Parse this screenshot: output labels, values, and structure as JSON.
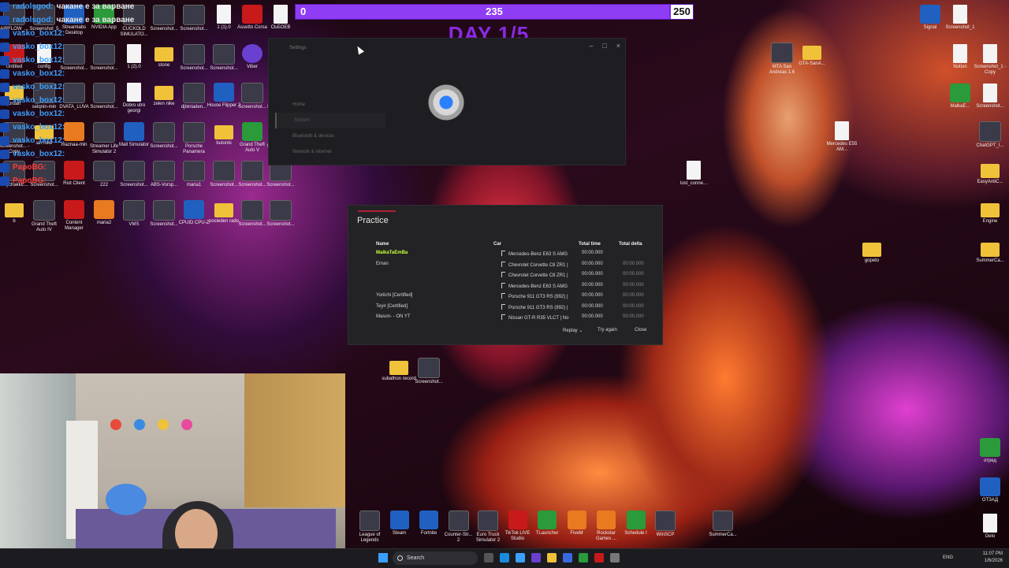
{
  "overlay": {
    "progress": {
      "start": "0",
      "current": "235",
      "end": "250",
      "fraction": 0.94
    },
    "day_label": "DAY 1/5"
  },
  "chat": [
    {
      "user": "radolsgod",
      "message": "чакане е за варване",
      "color": "blue"
    },
    {
      "user": "radolsgod",
      "message": "чакане е за варване",
      "color": "blue"
    },
    {
      "user": "vasko_box12",
      "message": "",
      "color": "blue"
    },
    {
      "user": "vasko_box12",
      "message": "",
      "color": "blue"
    },
    {
      "user": "vasko_box12",
      "message": "",
      "color": "blue"
    },
    {
      "user": "vasko_box12",
      "message": "",
      "color": "blue"
    },
    {
      "user": "vasko_box12",
      "message": "",
      "color": "blue"
    },
    {
      "user": "vasko_box12",
      "message": "",
      "color": "blue"
    },
    {
      "user": "vasko_box12",
      "message": "",
      "color": "blue"
    },
    {
      "user": "vasko_box12",
      "message": "",
      "color": "blue"
    },
    {
      "user": "vasko_box12",
      "message": "",
      "color": "blue"
    },
    {
      "user": "vasko_box12",
      "message": "",
      "color": "blue"
    },
    {
      "user": "PapoBG",
      "message": "",
      "color": "red"
    },
    {
      "user": "PapoBG",
      "message": "",
      "color": "red"
    }
  ],
  "desktop_icons_left": [
    {
      "label": "AIRFLOW_...",
      "kind": "shot"
    },
    {
      "label": "Screenshot_5",
      "kind": "shot"
    },
    {
      "label": "Streamlabs Desktop",
      "kind": "blue"
    },
    {
      "label": "NVIDIA App",
      "kind": "green"
    },
    {
      "label": "CUCKOLD SIMULATO...",
      "kind": "shot"
    },
    {
      "label": "Screenshot...",
      "kind": "shot"
    },
    {
      "label": "Screenshot...",
      "kind": "shot"
    },
    {
      "label": "1 (1).0",
      "kind": "file"
    },
    {
      "label": "Assetto Corsa",
      "kind": "red"
    },
    {
      "label": "СЬБОЕВ",
      "kind": "file"
    },
    {
      "label": "Untitled",
      "kind": "red"
    },
    {
      "label": "config",
      "kind": "file"
    },
    {
      "label": "Screenshot...",
      "kind": "shot"
    },
    {
      "label": "Screenshot...",
      "kind": "shot"
    },
    {
      "label": "1 (2).0",
      "kind": "file"
    },
    {
      "label": "stone",
      "kind": "folder"
    },
    {
      "label": "Screenshot...",
      "kind": "shot"
    },
    {
      "label": "Screenshot...",
      "kind": "shot"
    },
    {
      "label": "Viber",
      "kind": "purple"
    },
    {
      "label": "1 (3).0",
      "kind": "file"
    },
    {
      "label": "jordan",
      "kind": "folder"
    },
    {
      "label": "selqnin-min",
      "kind": "shot"
    },
    {
      "label": "DVATA_LUVA",
      "kind": "shot"
    },
    {
      "label": "Screenshot...",
      "kind": "shot"
    },
    {
      "label": "Dobro utro georgi",
      "kind": "file"
    },
    {
      "label": "zelen nike",
      "kind": "folder"
    },
    {
      "label": "djbinladen...",
      "kind": "shot"
    },
    {
      "label": "House Flipper 2",
      "kind": "blue"
    },
    {
      "label": "Screenshot...",
      "kind": "shot"
    },
    {
      "label": "Phasmoph...",
      "kind": "shot"
    },
    {
      "label": "Screenshot... - Copy",
      "kind": "shot"
    },
    {
      "label": "sin nike",
      "kind": "folder"
    },
    {
      "label": "maznaa-min",
      "kind": "orange"
    },
    {
      "label": "Streamer Life Simulator 2",
      "kind": "shot"
    },
    {
      "label": "Mall Simulator",
      "kind": "blue"
    },
    {
      "label": "Screenshot...",
      "kind": "shot"
    },
    {
      "label": "Porsche Panamera",
      "kind": "shot"
    },
    {
      "label": "butonki",
      "kind": "folder"
    },
    {
      "label": "Grand Theft Auto V",
      "kind": "green"
    },
    {
      "label": "Screenshot...",
      "kind": "shot"
    },
    {
      "label": "HaychakkE...",
      "kind": "shot"
    },
    {
      "label": "Screenshot...",
      "kind": "shot"
    },
    {
      "label": "Riot Client",
      "kind": "red"
    },
    {
      "label": "222",
      "kind": "shot"
    },
    {
      "label": "Screenshot...",
      "kind": "shot"
    },
    {
      "label": "ABS-Vorsp...",
      "kind": "shot"
    },
    {
      "label": "maria1",
      "kind": "shot"
    },
    {
      "label": "Screenshot...",
      "kind": "shot"
    },
    {
      "label": "Screenshot...",
      "kind": "shot"
    },
    {
      "label": "Screenshot...",
      "kind": "shot"
    },
    {
      "label": "b",
      "kind": "folder"
    },
    {
      "label": "Grand Theft Auto IV",
      "kind": "shot"
    },
    {
      "label": "Content Manager",
      "kind": "red"
    },
    {
      "label": "maria2",
      "kind": "orange"
    },
    {
      "label": "VMS",
      "kind": "shot"
    },
    {
      "label": "Screenshot...",
      "kind": "shot"
    },
    {
      "label": "CPUID CPU-Z",
      "kind": "blue"
    },
    {
      "label": "posleden rado",
      "kind": "folder"
    },
    {
      "label": "Screenshot...",
      "kind": "shot"
    },
    {
      "label": "Screenshot...",
      "kind": "shot"
    }
  ],
  "desktop_icons_right": [
    {
      "label": "MTA San Andreas 1.6",
      "kind": "shot"
    },
    {
      "label": "GTA-SanA...",
      "kind": "folder"
    },
    {
      "label": "Signal",
      "kind": "blue"
    },
    {
      "label": "Screenshot_1",
      "kind": "file"
    },
    {
      "label": "Notion",
      "kind": "file"
    },
    {
      "label": "Screenshot_1 - Copy",
      "kind": "file"
    },
    {
      "label": "MalkaE...",
      "kind": "green"
    },
    {
      "label": "Screenshot...",
      "kind": "file"
    },
    {
      "label": "Mercedes E55 AM...",
      "kind": "file"
    },
    {
      "label": "ChatGPT_I...",
      "kind": "shot"
    },
    {
      "label": "lost_conne...",
      "kind": "file"
    },
    {
      "label": "EasyAntiC...",
      "kind": "folder"
    },
    {
      "label": "Engine",
      "kind": "folder"
    },
    {
      "label": "gopeto",
      "kind": "folder"
    },
    {
      "label": "SummerCa...",
      "kind": "folder"
    },
    {
      "label": "subathon record",
      "kind": "folder"
    },
    {
      "label": "Screenshot...",
      "kind": "shot"
    },
    {
      "label": "отред",
      "kind": "green"
    },
    {
      "label": "ОТЗАД",
      "kind": "blue"
    },
    {
      "label": "Delo",
      "kind": "file"
    }
  ],
  "settings_window": {
    "title": "Settings",
    "controls": [
      "–",
      "□",
      "×"
    ],
    "nav": [
      "Home",
      "System",
      "Bluetooth & devices",
      "Network & internet"
    ],
    "active": "System"
  },
  "practice": {
    "title": "Practice",
    "headers": {
      "name": "Name",
      "car": "Car",
      "total_time": "Total time",
      "total_delta": "Total delta"
    },
    "rows": [
      {
        "name": "MalkaTaEmBa",
        "car": "Mercedes-Benz E63 S AMG",
        "time": "00:00.000",
        "delta": "",
        "me": true
      },
      {
        "name": "Eman",
        "car": "Chevrolet Corvette C8 ZR1 |",
        "time": "00:00.000",
        "delta": "00:00.000",
        "me": false
      },
      {
        "name": "",
        "car": "Chevrolet Corvette C8 ZR1 |",
        "time": "00:00.000",
        "delta": "00:00.000",
        "me": false
      },
      {
        "name": "",
        "car": "Mercedes-Benz E63 S AMG",
        "time": "00:00.000",
        "delta": "00:00.000",
        "me": false
      },
      {
        "name": "Yoriichi [Certified]",
        "car": "Porsche 911 GT3 RS (992) |",
        "time": "00:00.000",
        "delta": "00:00.000",
        "me": false
      },
      {
        "name": "Teyir [Certified]",
        "car": "Porsche 911 GT3 RS (992) |",
        "time": "00:00.000",
        "delta": "00:00.000",
        "me": false
      },
      {
        "name": "Mason- - ON YT",
        "car": "Nissan GT-R R35 VLCT | No",
        "time": "00:00.000",
        "delta": "00:00.000",
        "me": false
      }
    ],
    "buttons": {
      "replay": "Replay",
      "try_again": "Try again",
      "close": "Close"
    }
  },
  "pinned_apps": [
    {
      "label": "League of Legends",
      "kind": "shot"
    },
    {
      "label": "Steam",
      "kind": "blue"
    },
    {
      "label": "Fortnite",
      "kind": "blue"
    },
    {
      "label": "Counter-Str... 2",
      "kind": "shot"
    },
    {
      "label": "Euro Truck Simulator 2",
      "kind": "shot"
    },
    {
      "label": "TikTok LIVE Studio",
      "kind": "red"
    },
    {
      "label": "TLauncher",
      "kind": "green"
    },
    {
      "label": "FiveM",
      "kind": "orange"
    },
    {
      "label": "Rockstar Games ...",
      "kind": "orange"
    },
    {
      "label": "Schedule I",
      "kind": "green"
    },
    {
      "label": "WinSCP",
      "kind": "shot"
    },
    {
      "label": "SummerCa...",
      "kind": "shot"
    }
  ],
  "taskbar": {
    "search_placeholder": "Search",
    "lang": "ENG",
    "time": "11:07 PM",
    "date": "1/6/2026"
  }
}
